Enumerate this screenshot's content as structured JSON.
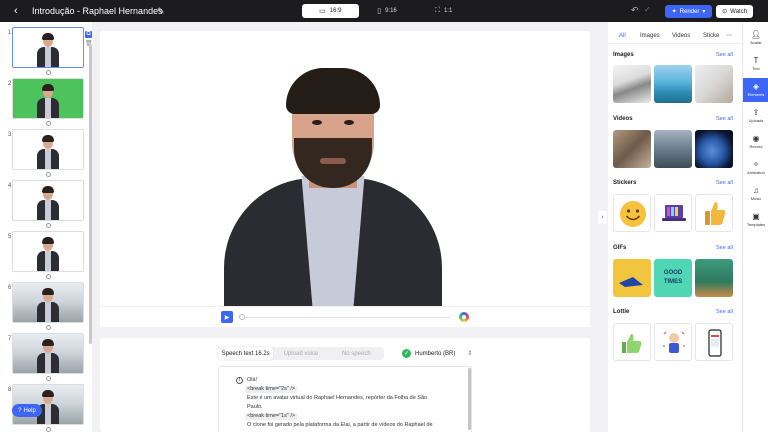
{
  "header": {
    "title": "Introdução - Raphael Hernandes",
    "aspect_ratios": [
      "16:9",
      "9:16",
      "1:1"
    ],
    "active_ratio": "16:9",
    "render_label": "Render",
    "watch_label": "Watch"
  },
  "slides": {
    "numbers": [
      "1",
      "2",
      "3",
      "4",
      "5",
      "6",
      "7",
      "8"
    ],
    "help_label": "Help"
  },
  "script": {
    "tabs": [
      "Speech text 16.2s",
      "Upload voice",
      "No speech"
    ],
    "voice": "Humberto (BR)",
    "lines": [
      "Olá!",
      "<break time=\"2s\" />",
      "Este é um avatar virtual do Raphael Hernandes, repórter da Folha de São",
      "Paulo.",
      "<break time=\"1s\" />",
      "O clone foi gerado pela plataforma da Elai, a partir de vídeos do Raphael de"
    ]
  },
  "assets": {
    "tabs": [
      "All",
      "Images",
      "Videos",
      "Sticke"
    ],
    "sections": [
      "Images",
      "Videos",
      "Stickers",
      "GIFs",
      "Lottie"
    ],
    "see_all": "See all",
    "gif_text": "GOOD TIMES"
  },
  "rail": {
    "items": [
      "Avatar",
      "Text",
      "Elements",
      "Uploads",
      "Record",
      "Animation",
      "Music",
      "Templates"
    ],
    "active": "Elements"
  },
  "colors": {
    "accent": "#3d66f5",
    "topbar": "#1c1c1e",
    "green_screen": "#4cc35c"
  }
}
